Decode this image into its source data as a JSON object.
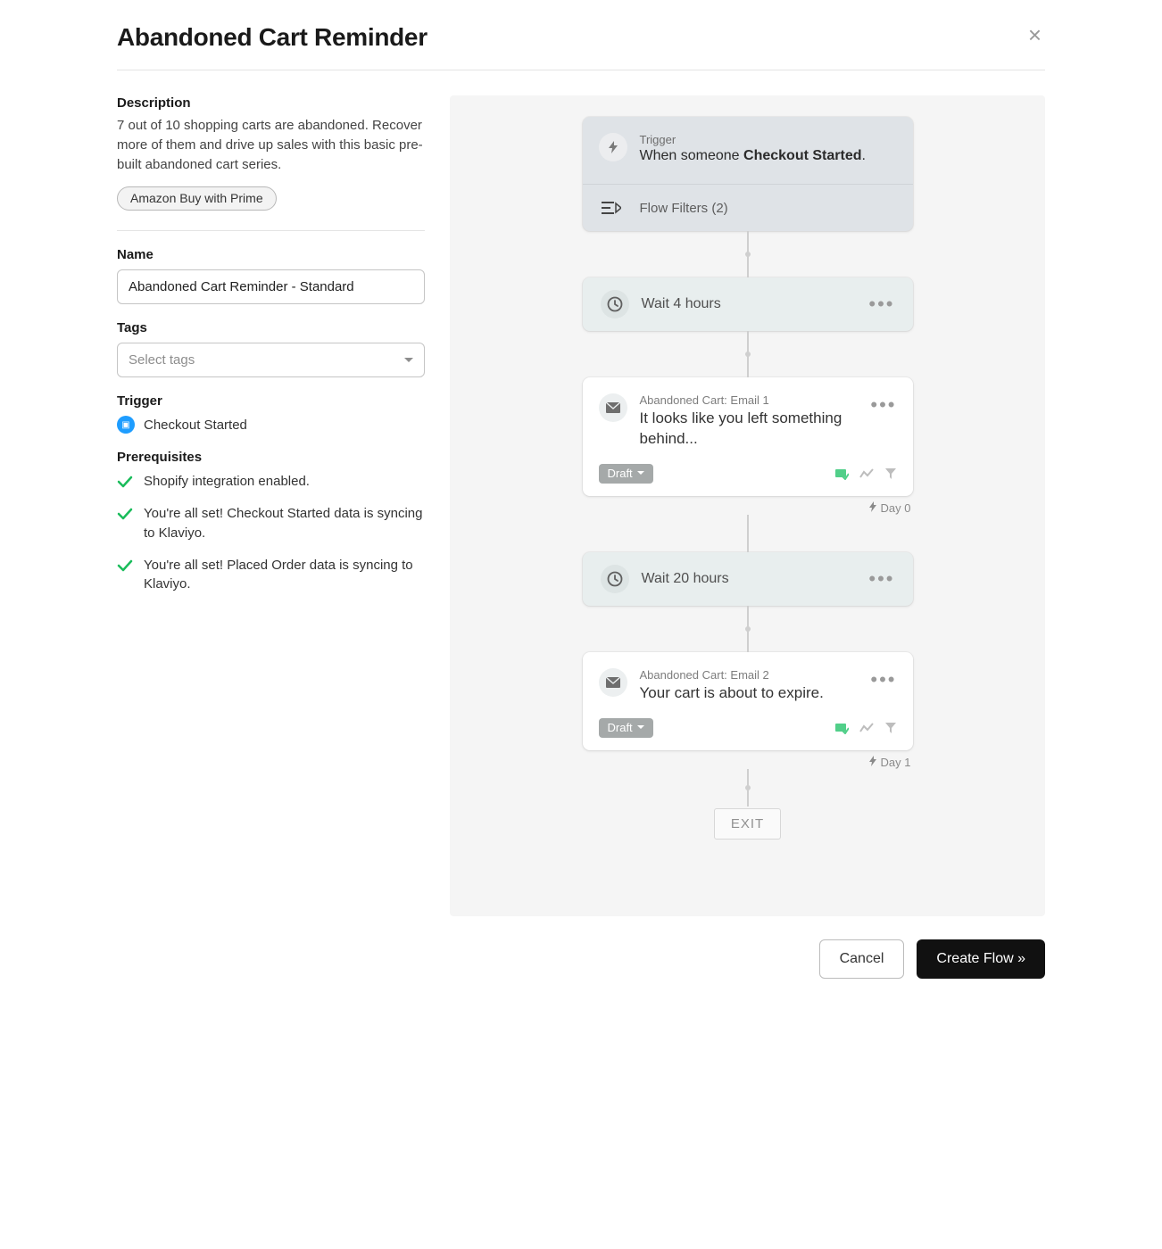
{
  "modal": {
    "title": "Abandoned Cart Reminder",
    "close_icon": "×"
  },
  "description": {
    "heading": "Description",
    "body": "7 out of 10 shopping carts are abandoned. Recover more of them and drive up sales with this basic pre-built abandoned cart series.",
    "chip": "Amazon Buy with Prime"
  },
  "name_field": {
    "label": "Name",
    "value": "Abandoned Cart Reminder - Standard"
  },
  "tags_field": {
    "label": "Tags",
    "placeholder": "Select tags"
  },
  "trigger_section": {
    "heading": "Trigger",
    "name": "Checkout Started"
  },
  "prereq": {
    "heading": "Prerequisites",
    "items": [
      "Shopify integration enabled.",
      "You're all set! Checkout Started data is syncing to Klaviyo.",
      "You're all set! Placed Order data is syncing to Klaviyo."
    ]
  },
  "flow": {
    "trigger_card": {
      "label": "Trigger",
      "prefix": "When someone ",
      "bold": "Checkout Started",
      "suffix": ".",
      "filters": "Flow Filters (2)"
    },
    "wait1": "Wait 4 hours",
    "email1": {
      "label": "Abandoned Cart: Email 1",
      "subject": "It looks like you left something behind...",
      "status": "Draft"
    },
    "day0": "Day 0",
    "wait2": "Wait 20 hours",
    "email2": {
      "label": "Abandoned Cart: Email 2",
      "subject": "Your cart is about to expire.",
      "status": "Draft"
    },
    "day1": "Day 1",
    "exit": "EXIT"
  },
  "footer": {
    "cancel": "Cancel",
    "create": "Create Flow »"
  }
}
